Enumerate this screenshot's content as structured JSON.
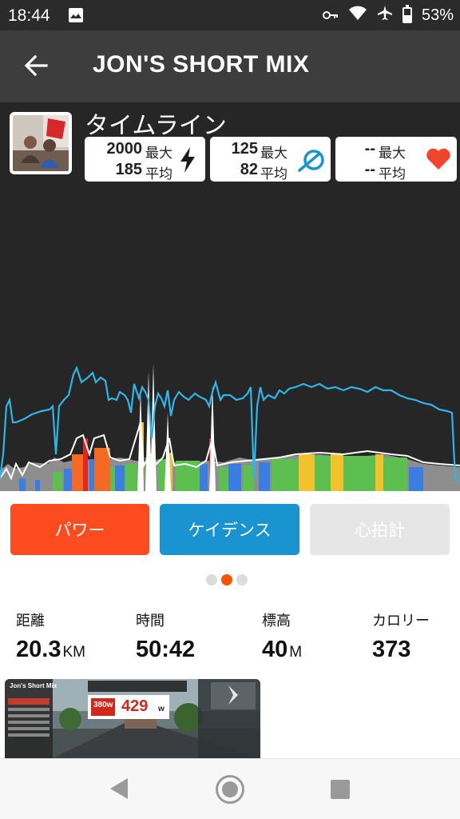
{
  "status_bar": {
    "time": "18:44",
    "battery": "53%"
  },
  "app_bar": {
    "title": "JON'S SHORT MIX"
  },
  "header": {
    "timeline_label": "タイムライン"
  },
  "stats": {
    "power": {
      "max": "2000",
      "max_label": "最大",
      "avg": "185",
      "avg_label": "平均",
      "icon": "lightning-icon"
    },
    "cadence": {
      "max": "125",
      "max_label": "最大",
      "avg": "82",
      "avg_label": "平均",
      "icon": "cadence-icon"
    },
    "heart_rate": {
      "max": "--",
      "max_label": "最大",
      "avg": "--",
      "avg_label": "平均",
      "icon": "heart-icon"
    }
  },
  "tabs": {
    "power": "パワー",
    "cadence": "ケイデンス",
    "heart_rate": "心拍計"
  },
  "pager": {
    "count": 3,
    "active": 1
  },
  "metrics": {
    "distance": {
      "label": "距離",
      "value": "20.3",
      "unit": "KM"
    },
    "time": {
      "label": "時間",
      "value": "50:42",
      "unit": ""
    },
    "elevation": {
      "label": "標高",
      "value": "40",
      "unit": "M"
    },
    "calories": {
      "label": "カロリー",
      "value": "373",
      "unit": ""
    }
  },
  "thumbnail": {
    "title": "Jon's Short Mix",
    "power_reading": "429",
    "power_unit": "w",
    "target": "380w"
  },
  "colors": {
    "zwift_orange": "#fc4c1f",
    "cadence_blue": "#1a93d1",
    "hr_grey": "#e6e6e6",
    "zone_grey": "#8e8e8e",
    "zone_blue": "#3b7de0",
    "zone_green": "#5cbf4f",
    "zone_yellow": "#f2c12e",
    "zone_orange": "#f46a24",
    "zone_red": "#e8251c"
  }
}
